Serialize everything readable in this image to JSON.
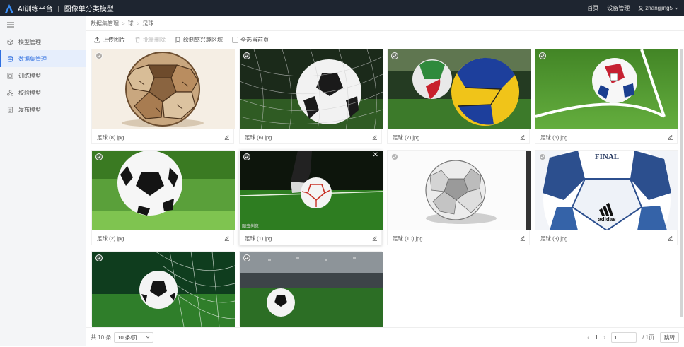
{
  "topbar": {
    "app_title": "AI训练平台",
    "separator": "|",
    "subtitle": "图像单分类模型",
    "links": [
      "首页",
      "设备管理"
    ],
    "user": "zhangjing5"
  },
  "sidebar": {
    "collapse_icon": "menu-fold-icon",
    "items": [
      {
        "label": "模型管理",
        "icon": "cube-icon"
      },
      {
        "label": "数据集管理",
        "icon": "database-icon"
      },
      {
        "label": "训练模型",
        "icon": "train-icon"
      },
      {
        "label": "校验模型",
        "icon": "share-icon"
      },
      {
        "label": "发布模型",
        "icon": "publish-icon"
      }
    ],
    "active_index": 1
  },
  "breadcrumb": [
    "数据集管理",
    "球",
    "足球"
  ],
  "toolbar": {
    "upload": "上传图片",
    "batch_delete": "批量删除",
    "draw_roi": "绘制感兴趣区域",
    "select_page": "全选当前页"
  },
  "cards": [
    {
      "name": "足球 (8).jpg"
    },
    {
      "name": "足球 (6).jpg"
    },
    {
      "name": "足球 (7).jpg"
    },
    {
      "name": "足球 (5).jpg"
    },
    {
      "name": "足球 (2).jpg"
    },
    {
      "name": "足球 (1).jpg"
    },
    {
      "name": "足球 (10).jpg"
    },
    {
      "name": "足球 (9).jpg"
    },
    {
      "name": ""
    },
    {
      "name": ""
    }
  ],
  "pager": {
    "total": "共 10 条",
    "page_size": "10 条/页",
    "current": "1",
    "input_value": "1",
    "total_pages": "/ 1页",
    "jump": "跳转"
  }
}
